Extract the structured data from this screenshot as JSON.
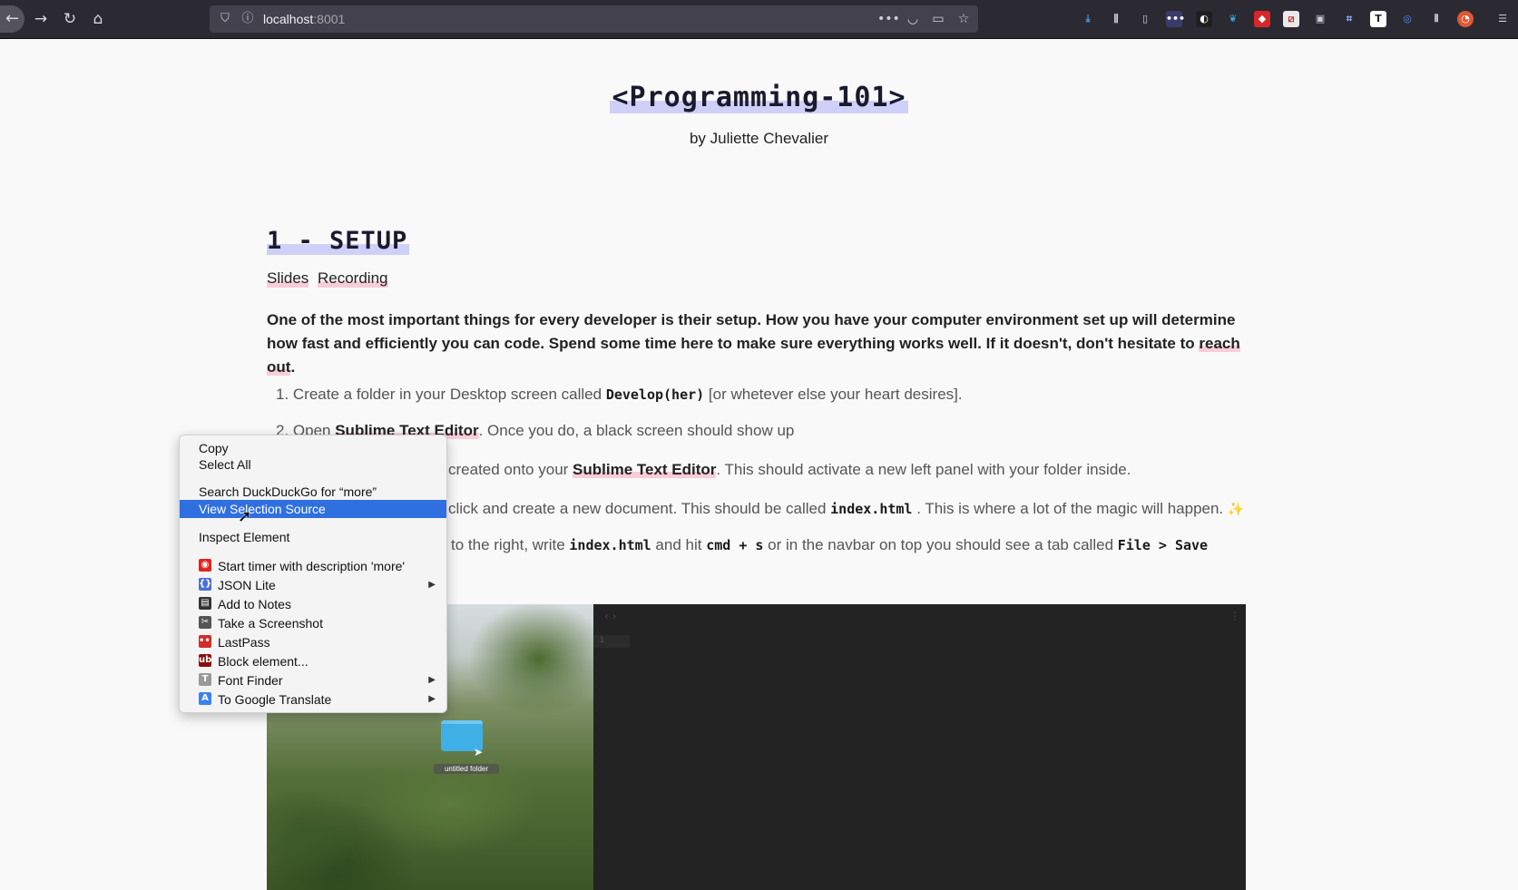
{
  "browser": {
    "url_host": "localhost",
    "url_port": ":8001"
  },
  "page": {
    "title": "<Programming-101>",
    "byline": "by Juliette Chevalier",
    "section_title": "1 - SETUP",
    "section_links": [
      "Slides",
      "Recording"
    ],
    "intro": "One of the most important things for every developer is their setup. How you have your computer environment set up will determine how fast and efficiently you can code. Spend some time here to make sure everything works well. If it doesn't, don't hesitate to ",
    "intro_link": "reach out",
    "intro_end": ".",
    "steps": {
      "s1_prefix": "1. Create a folder in your Desktop screen called ",
      "s1_code": "Develop(her)",
      "s1_suffix": " [or whetever else your heart desires].",
      "s2_prefix": "2. Open ",
      "s2_link": "Sublime Text Editor",
      "s2_suffix": ". Once you do, a black screen should show up",
      "s3_prefix": "created onto your ",
      "s3_link": "Sublime Text Editor",
      "s3_suffix": ". This should activate a new left panel with your folder inside.",
      "s4_prefix": "click and create a new document. This should be called ",
      "s4_code": "index.html",
      "s4_suffix": " . This is where a lot of the magic will happen. ",
      "s4_emoji": "✨",
      "s5_prefix": "to the right, write ",
      "s5_code1": "index.html",
      "s5_mid1": " and hit ",
      "s5_code2": "cmd + s",
      "s5_mid2": " or in the navbar on top you should see a tab called ",
      "s5_code3": "File > Save"
    }
  },
  "screenshot": {
    "editor_line_number": "1",
    "folder_label": "untitled folder"
  },
  "context_menu": {
    "copy": "Copy",
    "select_all": "Select All",
    "search": "Search DuckDuckGo for “more”",
    "view_source": "View Selection Source",
    "inspect": "Inspect Element",
    "ext_items": [
      {
        "label": "Start timer with description 'more'",
        "icon": "timer-icon",
        "color": "#e0241b",
        "glyph": "◉"
      },
      {
        "label": "JSON Lite",
        "icon": "json-lite-icon",
        "color": "#4a6fd6",
        "glyph": "{}",
        "submenu": true
      },
      {
        "label": "Add to Notes",
        "icon": "notes-icon",
        "color": "#333333",
        "glyph": "▤"
      },
      {
        "label": "Take a Screenshot",
        "icon": "screenshot-icon",
        "color": "#555555",
        "glyph": "✂"
      },
      {
        "label": "LastPass",
        "icon": "lastpass-icon",
        "color": "#d32d27",
        "glyph": "•••"
      },
      {
        "label": "Block element...",
        "icon": "ublock-icon",
        "color": "#8b0d0d",
        "glyph": "ub"
      },
      {
        "label": "Font Finder",
        "icon": "font-finder-icon",
        "color": "#9a9a9a",
        "glyph": "T",
        "submenu": true
      },
      {
        "label": "To Google Translate",
        "icon": "translate-icon",
        "color": "#3b82f0",
        "glyph": "A",
        "submenu": true
      }
    ]
  },
  "colors": {
    "title_highlight": "#cfd0f8",
    "link_highlight": "#f7cdd8",
    "menu_active": "#2f6fe0"
  }
}
